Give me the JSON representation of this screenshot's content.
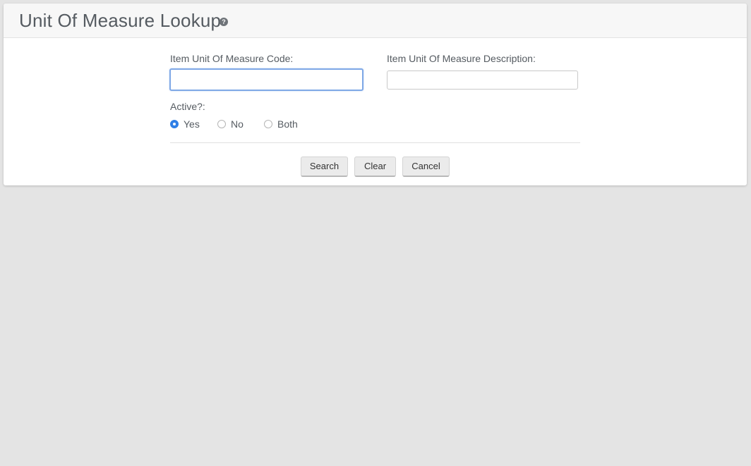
{
  "header": {
    "title": "Unit Of Measure Lookup",
    "help_glyph": "?"
  },
  "form": {
    "code_label": "Item Unit Of Measure Code:",
    "code_value": "",
    "description_label": "Item Unit Of Measure Description:",
    "description_value": "",
    "active_label": "Active?:",
    "active_options": [
      {
        "label": "Yes",
        "checked": true
      },
      {
        "label": "No",
        "checked": false
      },
      {
        "label": "Both",
        "checked": false
      }
    ]
  },
  "actions": {
    "search_label": "Search",
    "clear_label": "Clear",
    "cancel_label": "Cancel"
  },
  "colors": {
    "background": "#e4e4e4",
    "panel": "#ffffff",
    "accent": "#2f7fe6",
    "focus_border": "#7fa8e6"
  }
}
